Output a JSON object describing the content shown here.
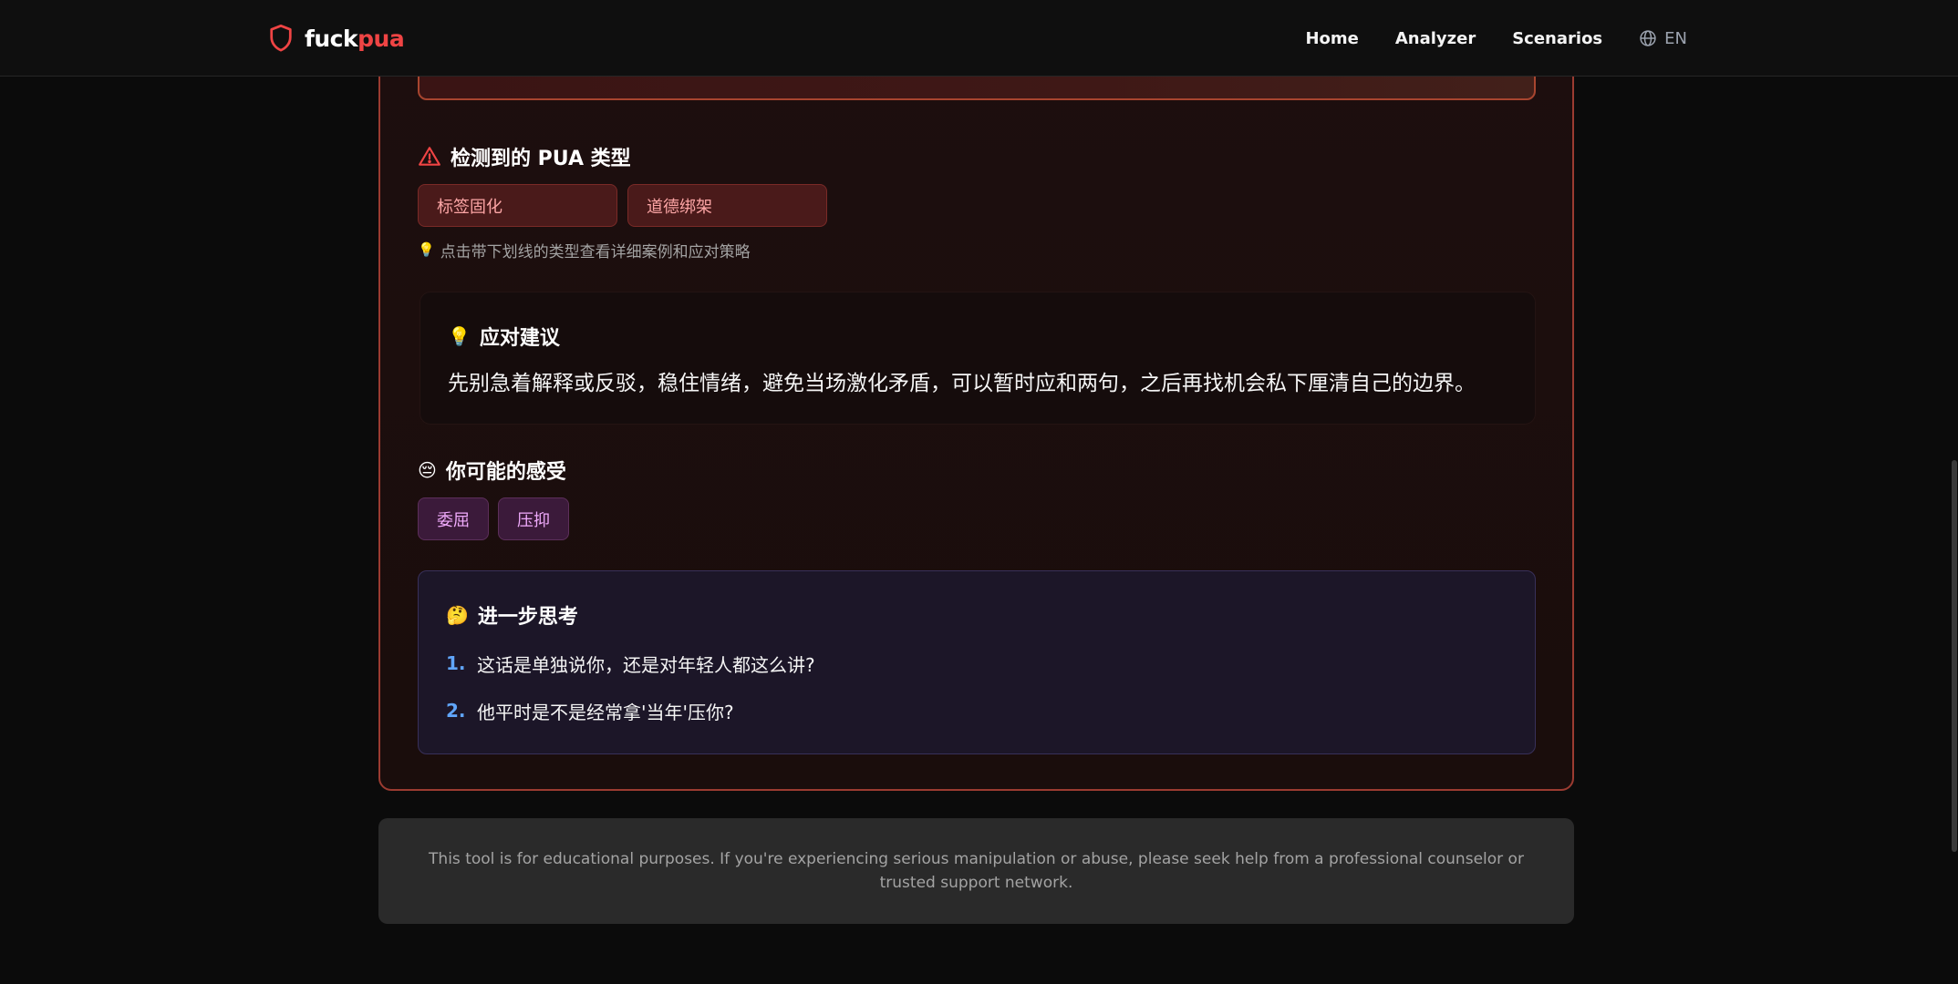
{
  "header": {
    "brand_part1": "fuck",
    "brand_part2": "pua",
    "nav": {
      "home": "Home",
      "analyzer": "Analyzer",
      "scenarios": "Scenarios",
      "lang": "EN"
    }
  },
  "result": {
    "pua_section_title": "检测到的 PUA 类型",
    "pua_types": [
      "标签固化",
      "道德绑架"
    ],
    "hint_icon": "💡",
    "hint_text": "点击带下划线的类型查看详细案例和应对策略",
    "advice": {
      "icon": "💡",
      "title": "应对建议",
      "text": "先别急着解释或反驳，稳住情绪，避免当场激化矛盾，可以暂时应和两句，之后再找机会私下厘清自己的边界。"
    },
    "feelings": {
      "icon": "😔",
      "title": "你可能的感受",
      "items": [
        "委屈",
        "压抑"
      ]
    },
    "think": {
      "icon": "🤔",
      "title": "进一步思考",
      "items": [
        {
          "num": "1.",
          "text": "这话是单独说你，还是对年轻人都这么讲?"
        },
        {
          "num": "2.",
          "text": "他平时是不是经常拿'当年'压你?"
        }
      ]
    }
  },
  "footer": {
    "text": "This tool is for educational purposes. If you're experiencing serious manipulation or abuse, please seek help from a professional counselor or trusted support network."
  },
  "colors": {
    "accent_red": "#ef4444",
    "card_border": "#9b3b31",
    "pua_chip_text": "#fca5a5",
    "feel_chip_text": "#f0abfc",
    "list_number": "#60a5fa"
  }
}
